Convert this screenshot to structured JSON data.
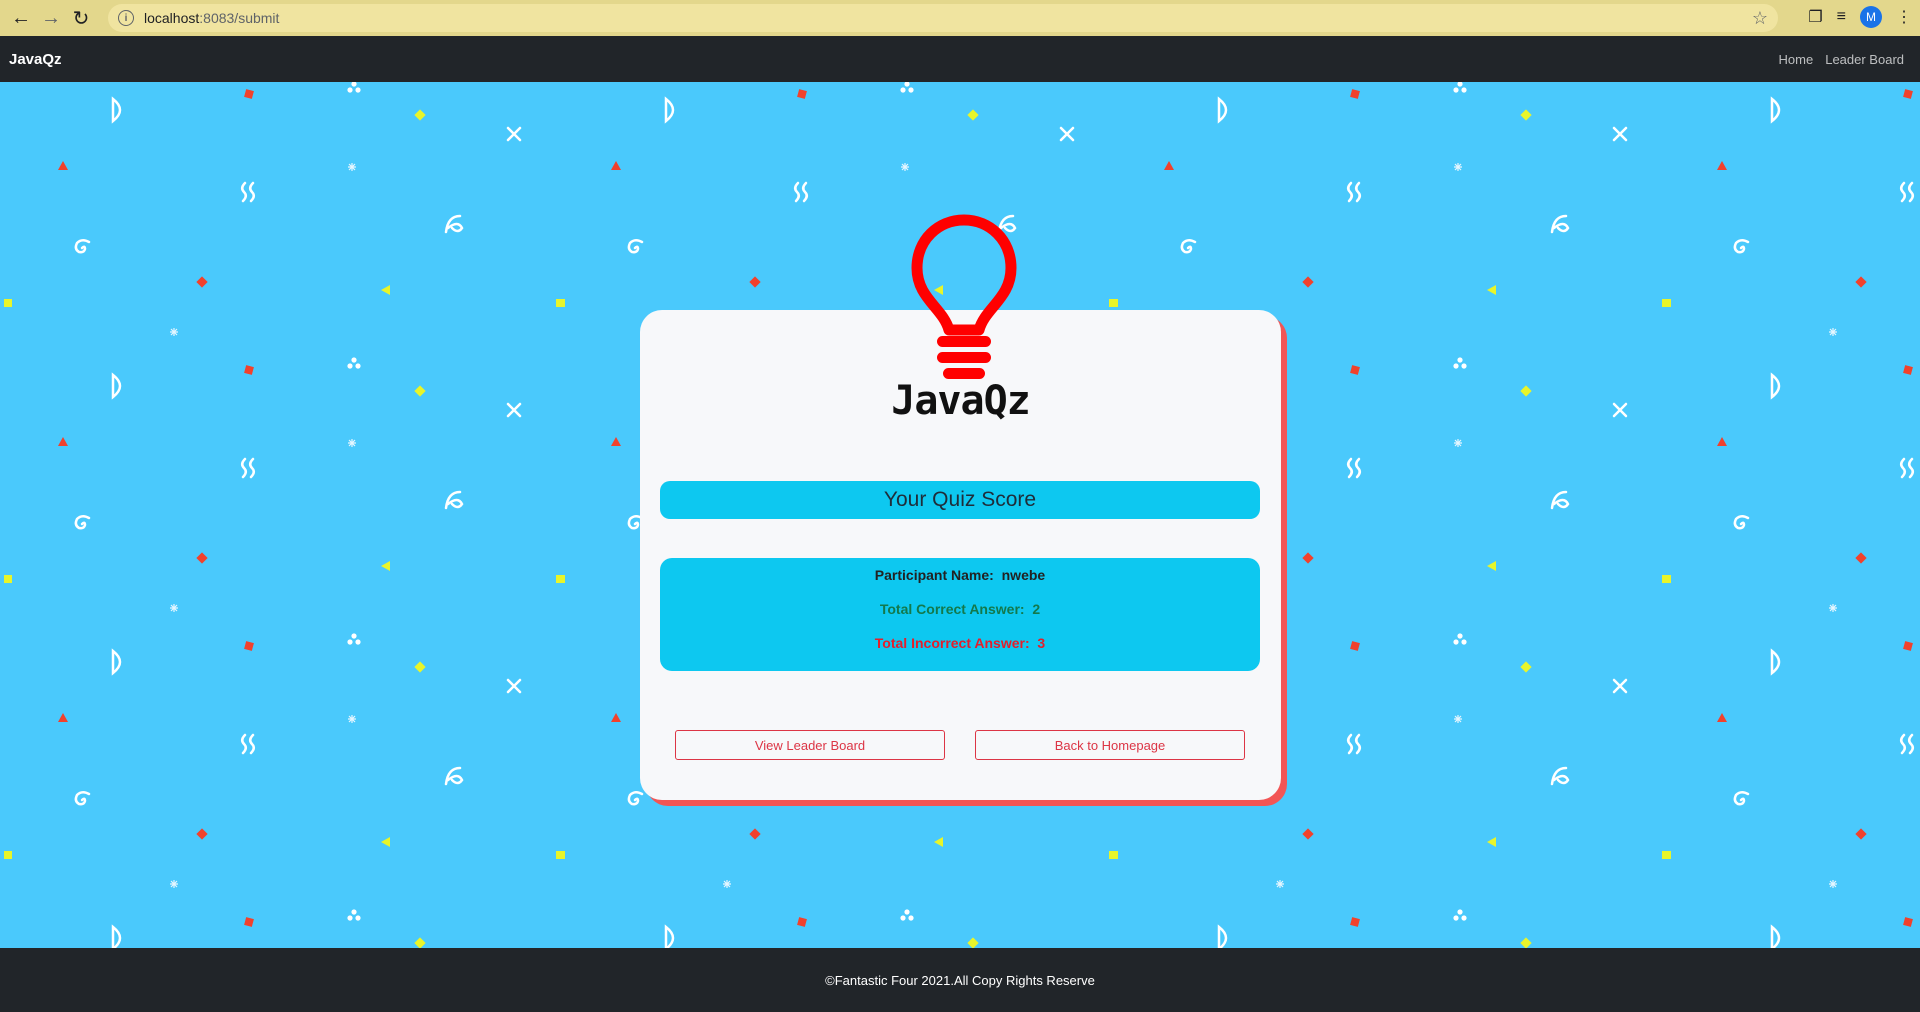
{
  "browser": {
    "url_host": "localhost",
    "url_path": ":8083/submit",
    "profile_initial": "M"
  },
  "navbar": {
    "brand": "JavaQz",
    "links": [
      "Home",
      "Leader Board"
    ]
  },
  "card": {
    "logo_text": "JavaQz",
    "score_title": "Your Quiz Score",
    "participant_label": "Participant Name:",
    "participant_name": "nwebe",
    "correct_label": "Total Correct Answer:",
    "correct_value": "2",
    "incorrect_label": "Total Incorrect Answer:",
    "incorrect_value": "3",
    "buttons": [
      "View Leader Board",
      "Back to Homepage"
    ]
  },
  "footer": {
    "text": "©Fantastic Four 2021.All Copy Rights Reserve"
  },
  "colors": {
    "background": "#4ac9fc",
    "navbar": "#212529",
    "accent_cyan": "#0dc8f0",
    "bulb_red": "#ff0000",
    "correct_green": "#13794c",
    "incorrect_red": "#e41e2b",
    "button_red": "#dc3545"
  }
}
